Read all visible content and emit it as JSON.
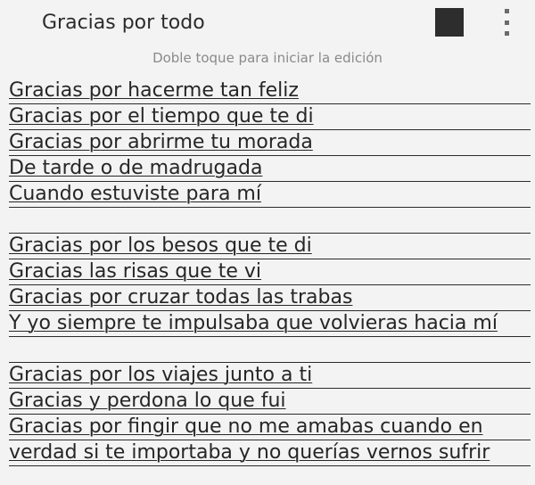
{
  "app_bar": {
    "title": "Gracias por todo",
    "color_swatch": "#2d2d2d",
    "overflow_icon": "more-vert-icon"
  },
  "hint": "Doble toque para iniciar la edición",
  "note": {
    "lines": [
      "Gracias por hacerme tan feliz",
      "Gracias por el tiempo que te di",
      "Gracias por abrirme tu morada",
      "De tarde o de madrugada",
      "Cuando estuviste para mí",
      "",
      "Gracias por los besos que te di",
      "Gracias las risas que te vi",
      "Gracias por cruzar todas las trabas",
      "Y yo siempre te impulsaba que volvieras hacia mí",
      "",
      "Gracias por los viajes junto a ti",
      "Gracias y perdona lo que fui",
      "Gracias por fingir que no me amabas cuando en",
      "verdad si te importaba y no querías vernos sufrir"
    ]
  }
}
